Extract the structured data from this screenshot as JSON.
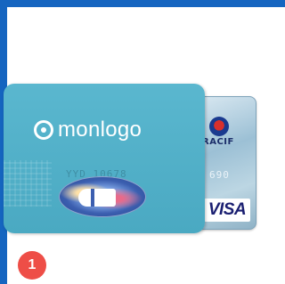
{
  "frame": {
    "accent_color": "#1565c0"
  },
  "cards": {
    "front": {
      "brand_text": "monlogo",
      "number_fragment": "YYD 10678",
      "color": "#4aa9c2"
    },
    "back": {
      "brand_text": "RACIF",
      "number_fragment": "690",
      "network_label": "VISA"
    }
  },
  "step": {
    "number": "1",
    "color": "#ee4e47"
  }
}
